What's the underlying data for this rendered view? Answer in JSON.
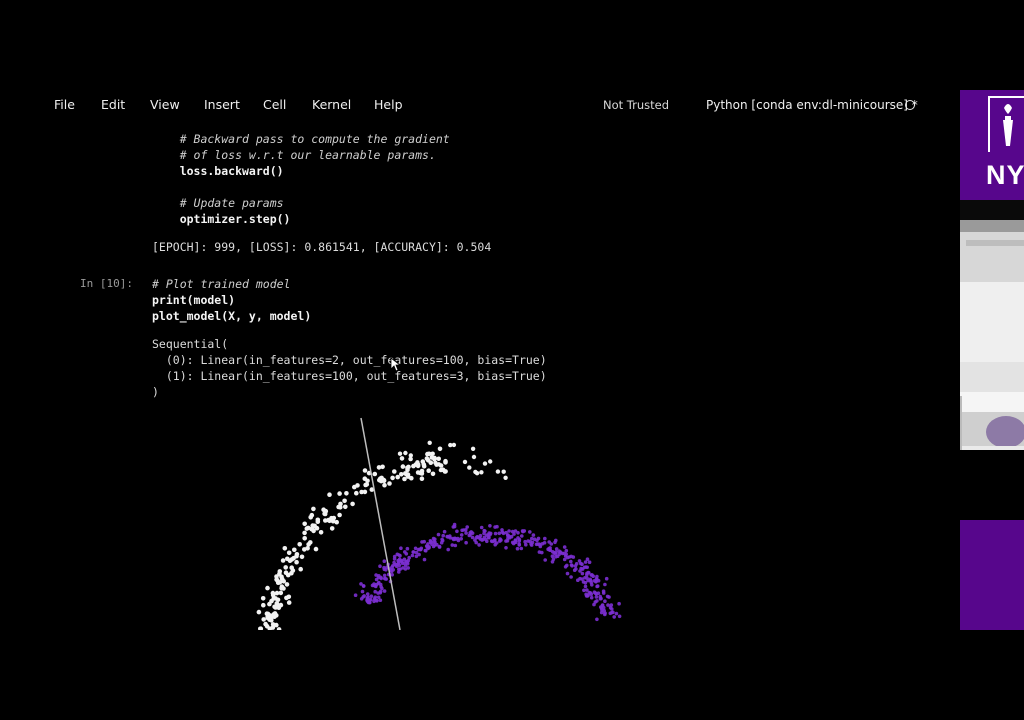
{
  "menu": {
    "items": [
      "File",
      "Edit",
      "View",
      "Insert",
      "Cell",
      "Kernel",
      "Help"
    ],
    "trust_status": "Not Trusted",
    "kernel_name": "Python [conda env:dl-minicourse] *"
  },
  "cell_prev": {
    "lines": [
      "    # Backward pass to compute the gradient",
      "    # of loss w.r.t our learnable params.",
      "    loss.backward()",
      "",
      "    # Update params",
      "    optimizer.step()"
    ],
    "output": "[EPOCH]: 999, [LOSS]: 0.861541, [ACCURACY]: 0.504"
  },
  "cell_current": {
    "prompt": "In [10]:",
    "lines": [
      "# Plot trained model",
      "print(model)",
      "plot_model(X, y, model)"
    ],
    "output": [
      "Sequential(",
      "  (0): Linear(in_features=2, out_features=100, bias=True)",
      "  (1): Linear(in_features=100, out_features=3, bias=True)",
      ")"
    ]
  },
  "slide": {
    "logo_text": "NY",
    "brand_color": "#57068c"
  },
  "plot": {
    "point_colors": [
      "#f2f2f2",
      "#7b2fd0"
    ],
    "boundary_color": "#bdbdbd"
  }
}
